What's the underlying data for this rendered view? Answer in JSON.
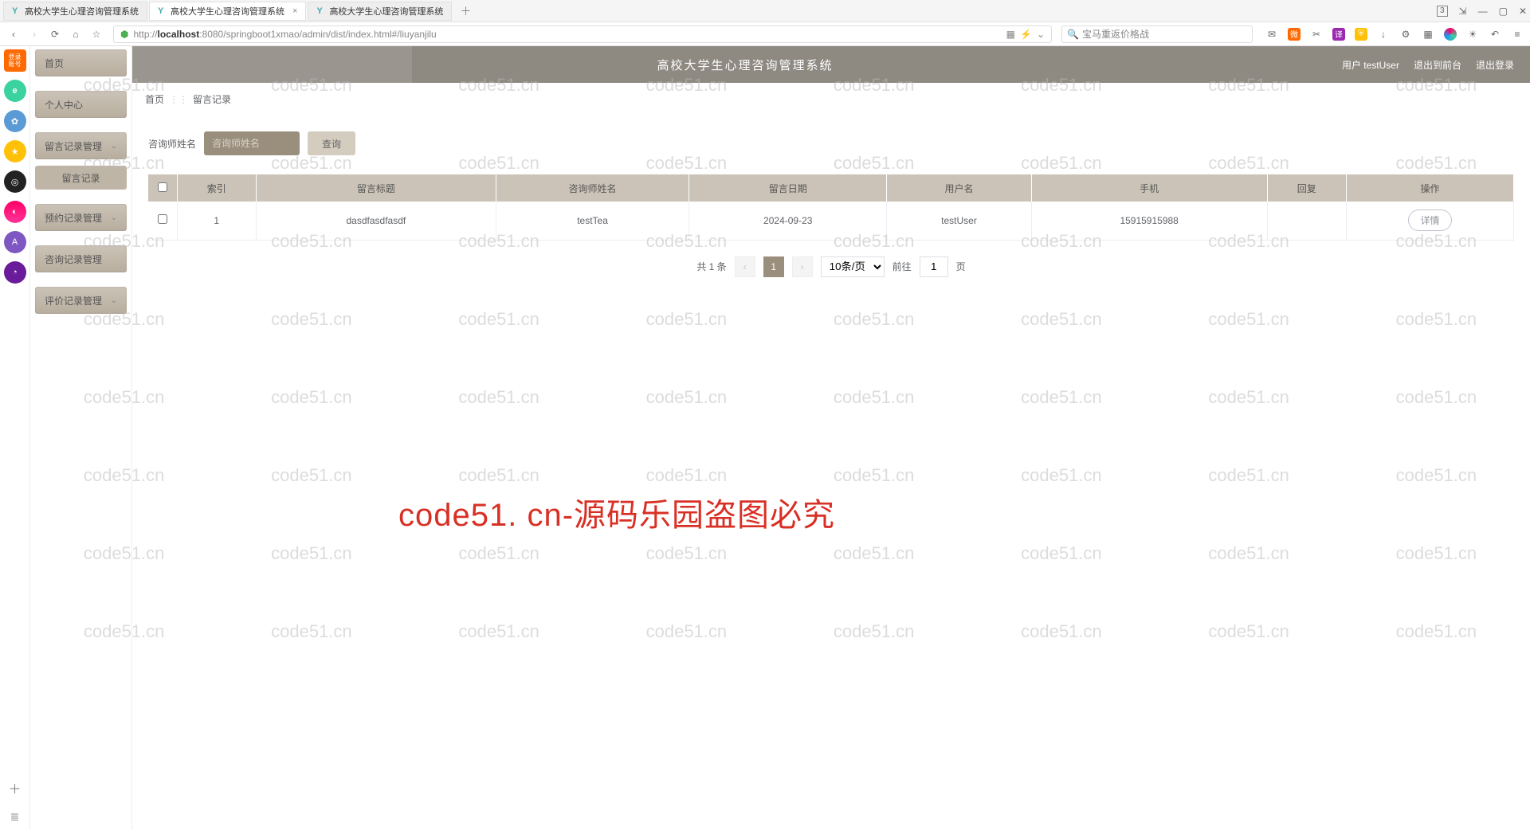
{
  "browser": {
    "tabs": [
      {
        "label": "高校大学生心理咨询管理系统",
        "active": false
      },
      {
        "label": "高校大学生心理咨询管理系统",
        "active": true
      },
      {
        "label": "高校大学生心理咨询管理系统",
        "active": false
      }
    ],
    "url_host": "localhost",
    "url_prefix": "http://",
    "url_port_path": ":8080/springboot1xmao/admin/dist/index.html#/liuyanjilu",
    "search_placeholder": "宝马重返价格战",
    "badge_count": "3"
  },
  "app": {
    "header": {
      "title": "高校大学生心理咨询管理系统",
      "user_label": "用户  testUser",
      "back_label": "退出到前台",
      "logout_label": "退出登录"
    },
    "breadcrumb": {
      "home": "首页",
      "current": "留言记录"
    },
    "sidebar": {
      "home": "首页",
      "personal": "个人中心",
      "msg": "留言记录管理",
      "msg_sub": "留言记录",
      "appt": "预约记录管理",
      "consult": "咨询记录管理",
      "review": "评价记录管理"
    },
    "filter": {
      "label": "咨询师姓名",
      "placeholder": "咨询师姓名",
      "value": "",
      "search_btn": "查询"
    },
    "table": {
      "headers": [
        "索引",
        "留言标题",
        "咨询师姓名",
        "留言日期",
        "用户名",
        "手机",
        "回复",
        "操作"
      ],
      "rows": [
        {
          "idx": "1",
          "title": "dasdfasdfasdf",
          "counselor": "testTea",
          "date": "2024-09-23",
          "user": "testUser",
          "phone": "15915915988",
          "reply": "",
          "action": "详情"
        }
      ]
    },
    "pagination": {
      "total": "共 1 条",
      "page": "1",
      "page_nav": "1",
      "per_page": "10条/页",
      "goto_prefix": "前往",
      "goto_suffix": "页"
    }
  },
  "watermark": {
    "repeat": "code51.cn",
    "big": "code51. cn-源码乐园盗图必究"
  }
}
